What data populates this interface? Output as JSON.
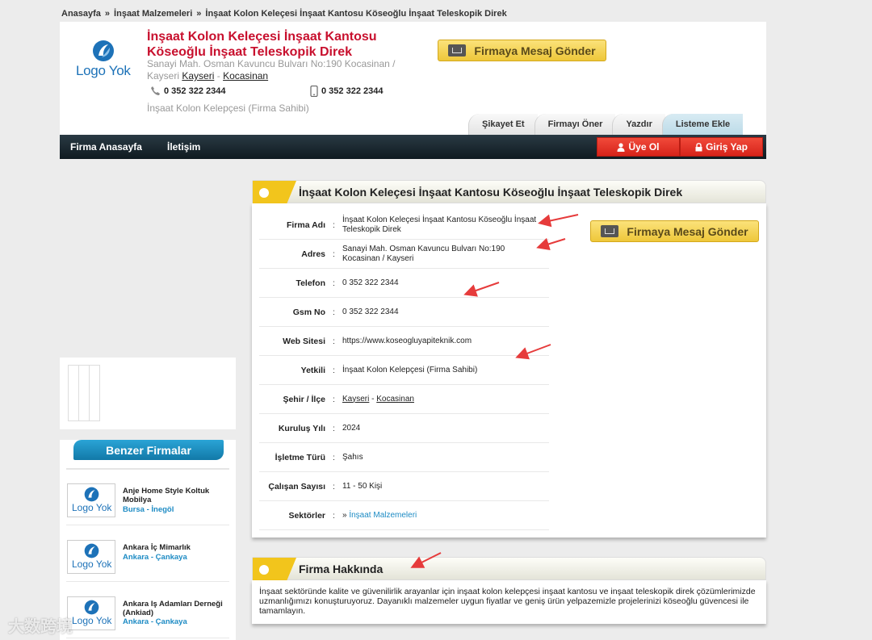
{
  "breadcrumb": {
    "home": "Anasayfa",
    "category": "İnşaat Malzemeleri",
    "current": "İnşaat Kolon Keleçesi İnşaat Kantosu Köseoğlu İnşaat Teleskopik Direk",
    "separator": "»"
  },
  "header": {
    "logo_text": "Logo Yok",
    "title": "İnşaat Kolon Keleçesi İnşaat Kantosu Köseoğlu İnşaat Teleskopik Direk",
    "address_prefix": "Sanayi Mah. Osman Kavuncu Bulvarı No:190 Kocasinan / Kayseri",
    "city": "Kayseri",
    "city_sep": "-",
    "district": "Kocasinan",
    "phone": "0 352 322 2344",
    "mobile": "0 352 322 2344",
    "owner": "İnşaat Kolon Kelepçesi (Firma Sahibi)",
    "message_button": "Firmaya Mesaj Gönder"
  },
  "tabs": [
    "Şikayet Et",
    "Firmayı Öner",
    "Yazdır",
    "Listeme Ekle"
  ],
  "nav": {
    "home": "Firma Anasayfa",
    "contact": "İletişim",
    "register": "Üye Ol",
    "login": "Giriş Yap"
  },
  "similar": {
    "title": "Benzer Firmalar",
    "logo_text": "Logo Yok",
    "items": [
      {
        "name": "Anje Home Style Koltuk Mobilya",
        "city": "Bursa",
        "sep": "-",
        "district": "İnegöl"
      },
      {
        "name": "Ankara İç Mimarlık",
        "city": "Ankara",
        "sep": "-",
        "district": "Çankaya"
      },
      {
        "name": "Ankara Iş Adamları Derneği (Ankiad)",
        "city": "Ankara",
        "sep": "-",
        "district": "Çankaya"
      }
    ]
  },
  "main": {
    "title": "İnşaat Kolon Keleçesi İnşaat Kantosu Köseoğlu İnşaat Teleskopik Direk",
    "colon": ":",
    "rows": [
      {
        "label": "Firma Adı",
        "value": "İnşaat Kolon Keleçesi İnşaat Kantosu Köseoğlu İnşaat Teleskopik Direk"
      },
      {
        "label": "Adres",
        "value": "Sanayi Mah. Osman Kavuncu Bulvarı No:190 Kocasinan / Kayseri"
      },
      {
        "label": "Telefon",
        "value": "0 352 322 2344"
      },
      {
        "label": "Gsm No",
        "value": "0 352 322 2344"
      },
      {
        "label": "Web Sitesi",
        "value": "https://www.koseogluyapiteknik.com"
      },
      {
        "label": "Yetkili",
        "value": "İnşaat Kolon Kelepçesi (Firma Sahibi)"
      },
      {
        "label": "Şehir / İlçe",
        "city": "Kayseri",
        "sep": "-",
        "district": "Kocasinan"
      },
      {
        "label": "Kuruluş Yılı",
        "value": "2024"
      },
      {
        "label": "İşletme Türü",
        "value": "Şahıs"
      },
      {
        "label": "Çalışan Sayısı",
        "value": "11 - 50 Kişi"
      },
      {
        "label": "Sektörler",
        "bullet": "»",
        "value": "İnşaat Malzemeleri"
      }
    ],
    "message_button": "Firmaya Mesaj Gönder"
  },
  "about": {
    "title": "Firma Hakkında",
    "text": "İnşaat sektöründe kalite ve güvenilirlik arayanlar için inşaat kolon kelepçesi inşaat kantosu ve inşaat teleskopik direk çözümlerimizde uzmanlığımızı konuşturuyoruz. Dayanıklı malzemeler uygun fiyatlar ve geniş ürün yelpazemizle projelerinizi köseoğlu güvencesi ile tamamlayın."
  },
  "watermark": "大数跨境",
  "colors": {
    "title_red": "#c8102e",
    "link_blue": "#1d8bc4",
    "nav_dark": "#1b2830",
    "button_red": "#e0301f",
    "button_yellow": "#f5d34f",
    "accent_yellow": "#f2c51c",
    "arrow_red": "#e63b3b"
  }
}
